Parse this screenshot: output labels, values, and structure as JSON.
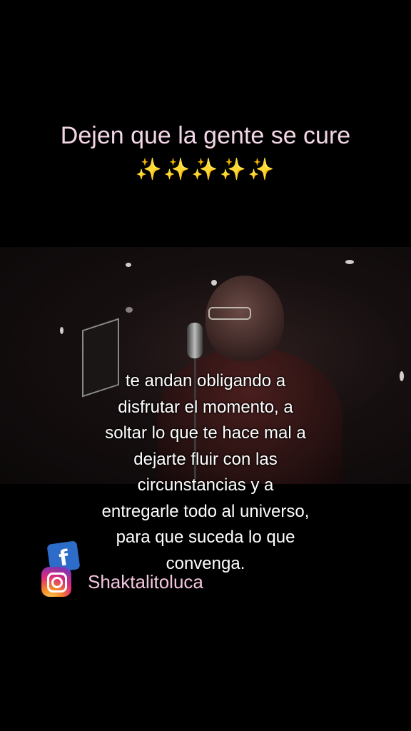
{
  "caption": {
    "title": "Dejen que la gente se cure",
    "emoji": "✨✨✨✨✨"
  },
  "overlay": {
    "lines": [
      "te andan obligando a",
      "disfrutar el momento, a",
      "soltar lo que te hace mal a",
      "dejarte fluir con las",
      "circunstancias y a",
      "entregarle todo al universo,",
      "para que suceda lo que",
      "convenga."
    ]
  },
  "social": {
    "handle": "Shaktalitoluca"
  },
  "colors": {
    "caption": "#f3d6e6",
    "sparkle": "#f5d76e",
    "handle": "#f4c6de"
  }
}
